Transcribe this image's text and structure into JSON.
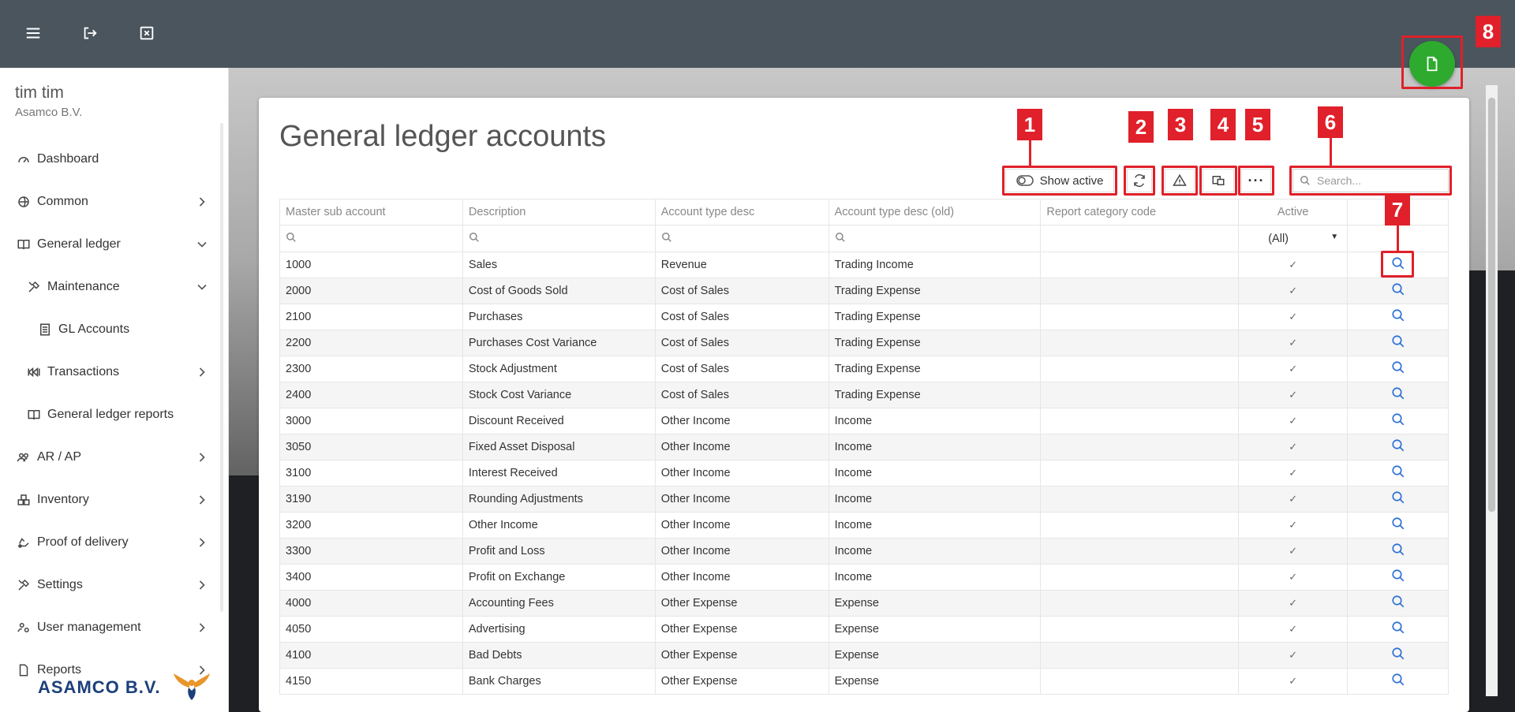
{
  "topbar": {
    "menu_icon": "hamburger-icon",
    "logout_icon": "logout-icon",
    "close_icon": "close-box-icon"
  },
  "fab": {
    "icon": "document-icon",
    "color": "#2eaa2e"
  },
  "sidebar": {
    "user_name": "tim tim",
    "company": "Asamco B.V.",
    "items": [
      {
        "label": "Dashboard",
        "icon": "dashboard-icon"
      },
      {
        "label": "Common",
        "icon": "globe-icon"
      },
      {
        "label": "General ledger",
        "icon": "book-icon"
      },
      {
        "label": "Maintenance",
        "icon": "tools-icon"
      },
      {
        "label": "GL Accounts",
        "icon": "ledger-icon"
      },
      {
        "label": "Transactions",
        "icon": "transactions-icon"
      },
      {
        "label": "General ledger reports",
        "icon": "book-icon"
      },
      {
        "label": "AR / AP",
        "icon": "users-icon"
      },
      {
        "label": "Inventory",
        "icon": "inventory-icon"
      },
      {
        "label": "Proof of delivery",
        "icon": "delivery-icon"
      },
      {
        "label": "Settings",
        "icon": "tools-icon"
      },
      {
        "label": "User management",
        "icon": "user-gear-icon"
      },
      {
        "label": "Reports",
        "icon": "file-icon"
      }
    ],
    "logo_text": "ASAMCO B.V."
  },
  "page": {
    "title": "General ledger accounts"
  },
  "toolbar": {
    "show_active_label": "Show active",
    "search_placeholder": "Search..."
  },
  "markers": [
    "1",
    "2",
    "3",
    "4",
    "5",
    "6",
    "7",
    "8"
  ],
  "table": {
    "columns": [
      "Master sub account",
      "Description",
      "Account type desc",
      "Account type desc (old)",
      "Report category code",
      "Active",
      ""
    ],
    "active_filter": "(All)",
    "rows": [
      [
        "1000",
        "Sales",
        "Revenue",
        "Trading Income",
        "",
        "✓"
      ],
      [
        "2000",
        "Cost of Goods Sold",
        "Cost of Sales",
        "Trading Expense",
        "",
        "✓"
      ],
      [
        "2100",
        "Purchases",
        "Cost of Sales",
        "Trading Expense",
        "",
        "✓"
      ],
      [
        "2200",
        "Purchases Cost Variance",
        "Cost of Sales",
        "Trading Expense",
        "",
        "✓"
      ],
      [
        "2300",
        "Stock Adjustment",
        "Cost of Sales",
        "Trading Expense",
        "",
        "✓"
      ],
      [
        "2400",
        "Stock Cost Variance",
        "Cost of Sales",
        "Trading Expense",
        "",
        "✓"
      ],
      [
        "3000",
        "Discount Received",
        "Other Income",
        "Income",
        "",
        "✓"
      ],
      [
        "3050",
        "Fixed Asset Disposal",
        "Other Income",
        "Income",
        "",
        "✓"
      ],
      [
        "3100",
        "Interest Received",
        "Other Income",
        "Income",
        "",
        "✓"
      ],
      [
        "3190",
        "Rounding Adjustments",
        "Other Income",
        "Income",
        "",
        "✓"
      ],
      [
        "3200",
        "Other Income",
        "Other Income",
        "Income",
        "",
        "✓"
      ],
      [
        "3300",
        "Profit and Loss",
        "Other Income",
        "Income",
        "",
        "✓"
      ],
      [
        "3400",
        "Profit on Exchange",
        "Other Income",
        "Income",
        "",
        "✓"
      ],
      [
        "4000",
        "Accounting Fees",
        "Other Expense",
        "Expense",
        "",
        "✓"
      ],
      [
        "4050",
        "Advertising",
        "Other Expense",
        "Expense",
        "",
        "✓"
      ],
      [
        "4100",
        "Bad Debts",
        "Other Expense",
        "Expense",
        "",
        "✓"
      ],
      [
        "4150",
        "Bank Charges",
        "Other Expense",
        "Expense",
        "",
        "✓"
      ]
    ]
  }
}
